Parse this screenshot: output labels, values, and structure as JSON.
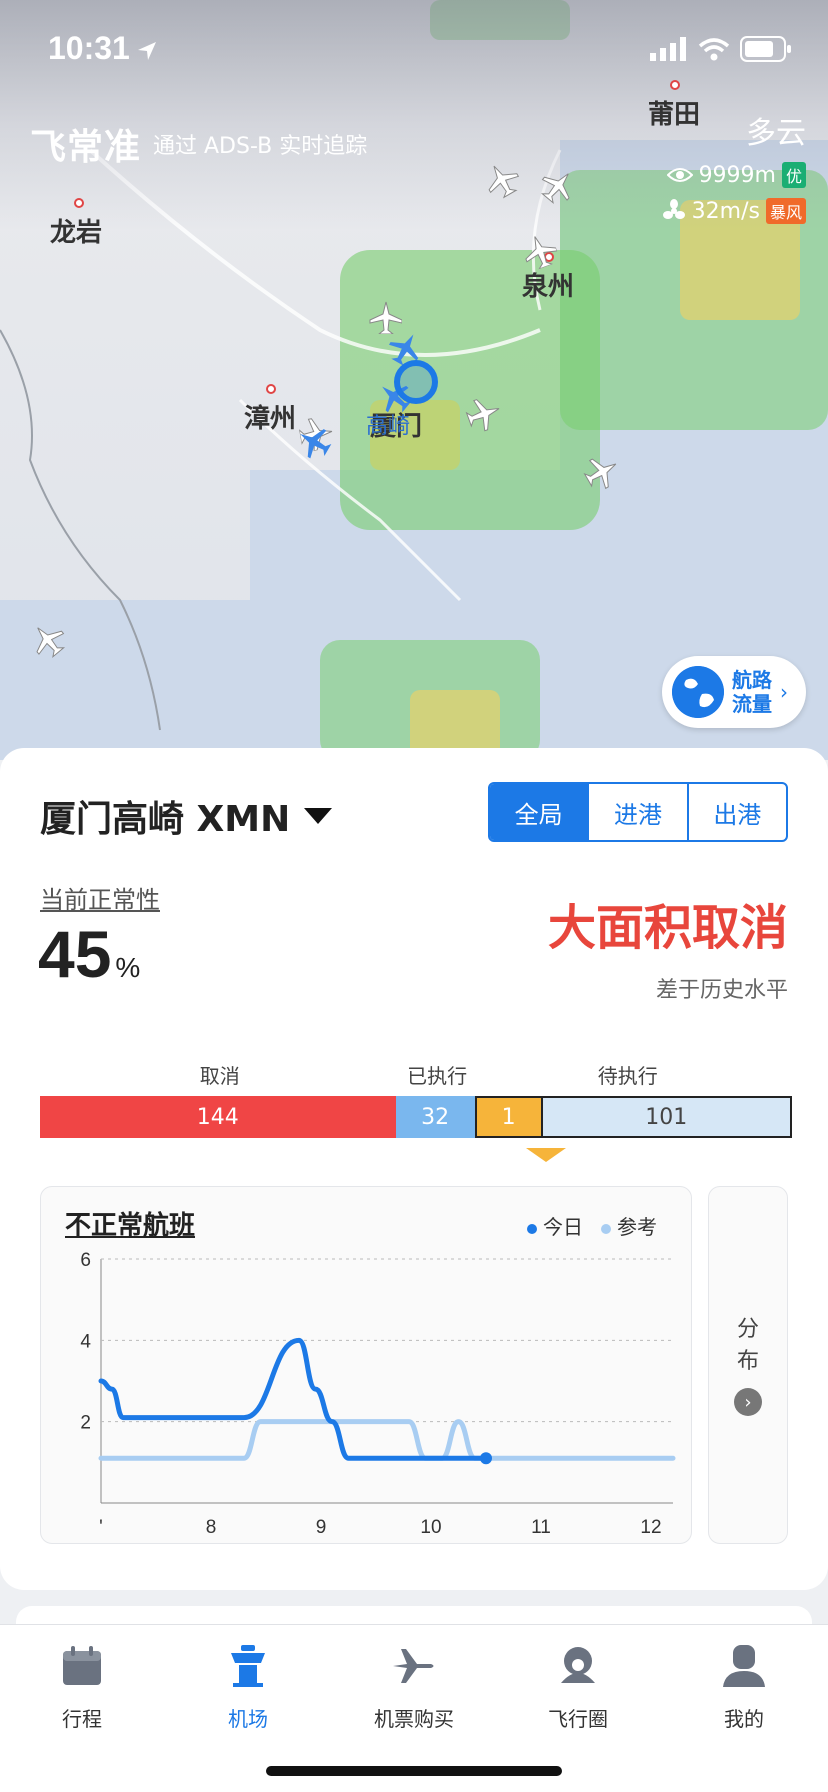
{
  "status_bar": {
    "time": "10:31"
  },
  "brand": {
    "logo": "飞常准",
    "subtitle": "通过 ADS-B 实时追踪"
  },
  "weather": {
    "condition": "多云",
    "visibility": "9999m",
    "visibility_tag": "优",
    "wind": "32m/s",
    "wind_tag": "暴风",
    "visibility_tag_color": "#1aae73",
    "wind_tag_color": "#f06a2a"
  },
  "map": {
    "cities": [
      "龙岩",
      "莆田",
      "泉州",
      "漳州",
      "厦门"
    ],
    "airport_label": "高崎",
    "route_button": {
      "line1": "航路",
      "line2": "流量"
    }
  },
  "airport": {
    "name": "厦门高崎 XMN",
    "tabs": [
      "全局",
      "进港",
      "出港"
    ],
    "active_tab": "全局"
  },
  "normality": {
    "label": "当前正常性",
    "value": "45",
    "unit": "%",
    "status": "大面积取消",
    "comparison": "差于历史水平"
  },
  "flights": {
    "labels": {
      "cancelled": "取消",
      "executed": "已执行",
      "pending": "待执行"
    },
    "cancelled": 144,
    "executed": 32,
    "highlight": 1,
    "pending": 101,
    "colors": {
      "cancelled": "#f04545",
      "executed": "#7ab7ee",
      "highlight": "#f6b43a",
      "pending": "#d6e7f6"
    }
  },
  "chart": {
    "title": "不正常航班",
    "distribution": {
      "line1": "分",
      "line2": "布"
    }
  },
  "chart_data": {
    "type": "line",
    "xlim": [
      7,
      12.2
    ],
    "ylim": [
      0,
      6
    ],
    "x_ticks": [
      "'",
      "8",
      "9",
      "10",
      "11",
      "12"
    ],
    "y_ticks": [
      "2",
      "4",
      "6"
    ],
    "grid": true,
    "legend_position": "top-right",
    "series": [
      {
        "name": "今日",
        "color": "#1c79e6",
        "x": [
          7.0,
          7.1,
          7.2,
          8.3,
          8.8,
          8.95,
          9.1,
          9.25,
          10.5
        ],
        "y": [
          3.0,
          2.8,
          2.1,
          2.1,
          4.0,
          2.8,
          2.0,
          1.1,
          1.1
        ]
      },
      {
        "name": "参考",
        "color": "#a8cdf2",
        "x": [
          7.0,
          8.3,
          8.45,
          9.8,
          9.95,
          10.1,
          10.25,
          10.4,
          12.2
        ],
        "y": [
          1.1,
          1.1,
          2.0,
          2.0,
          1.1,
          1.1,
          2.0,
          1.1,
          1.1
        ]
      }
    ]
  },
  "tabbar": {
    "items": [
      "行程",
      "机场",
      "机票购买",
      "飞行圈",
      "我的"
    ],
    "active": "机场",
    "active_color": "#1c79e6",
    "inactive_color": "#6a7280"
  }
}
